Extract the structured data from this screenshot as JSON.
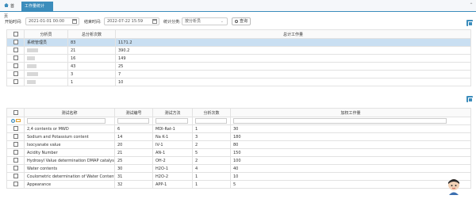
{
  "tabs": {
    "home": "首页",
    "active": "工作量统计",
    "close": "✕"
  },
  "filter": {
    "start_label": "开始时间:",
    "start_value": "2021-01-01 00:00",
    "end_label": "结束时间:",
    "end_value": "2022-07-22 15:59",
    "category_label": "统计分类:",
    "category_value": "按分析员",
    "query_button": "查询"
  },
  "summary_table": {
    "headers": [
      "分析员",
      "总分析次数",
      "总计工作量"
    ],
    "rows": [
      {
        "analyst": "系统管理员",
        "count": "83",
        "workload": "1171.2",
        "selected": true
      },
      {
        "analyst": "",
        "count": "21",
        "workload": "390.2"
      },
      {
        "analyst": "",
        "count": "16",
        "workload": "149"
      },
      {
        "analyst": "",
        "count": "43",
        "workload": "25"
      },
      {
        "analyst": "",
        "count": "3",
        "workload": "7"
      },
      {
        "analyst": "",
        "count": "1",
        "workload": "10"
      }
    ]
  },
  "detail_table": {
    "headers": [
      "测试名称",
      "测试编号",
      "测试方法",
      "分析次数",
      "加权工作量"
    ],
    "rows": [
      {
        "name": "2,4 contents or MWD",
        "no": "6",
        "method": "MDI-Rat-1",
        "count": "1",
        "weighted": "30"
      },
      {
        "name": "Sodium and Potassium content",
        "no": "14",
        "method": "Na K-1",
        "count": "3",
        "weighted": "180"
      },
      {
        "name": "Isocyanate value",
        "no": "20",
        "method": "IV-1",
        "count": "2",
        "weighted": "80"
      },
      {
        "name": "Acidity Number",
        "no": "21",
        "method": "AN-1",
        "count": "5",
        "weighted": "150"
      },
      {
        "name": "Hydroxyl Value determination DMAP catalysed",
        "no": "25",
        "method": "OH-2",
        "count": "2",
        "weighted": "100"
      },
      {
        "name": "Water contents",
        "no": "30",
        "method": "H2O-1",
        "count": "4",
        "weighted": "40"
      },
      {
        "name": "Coulometric determination of Water Content",
        "no": "31",
        "method": "H2O-2",
        "count": "1",
        "weighted": "10"
      },
      {
        "name": "Appearance",
        "no": "32",
        "method": "APP-1",
        "count": "1",
        "weighted": "5"
      }
    ]
  },
  "colors": {
    "accent": "#3c8dbc",
    "selected_row": "#c9dff2"
  },
  "icons": [
    "home-icon",
    "calendar-icon",
    "search-icon",
    "excel-export-icon",
    "radio-icon",
    "folder-icon",
    "avatar-icon",
    "chevron-up-icon"
  ]
}
